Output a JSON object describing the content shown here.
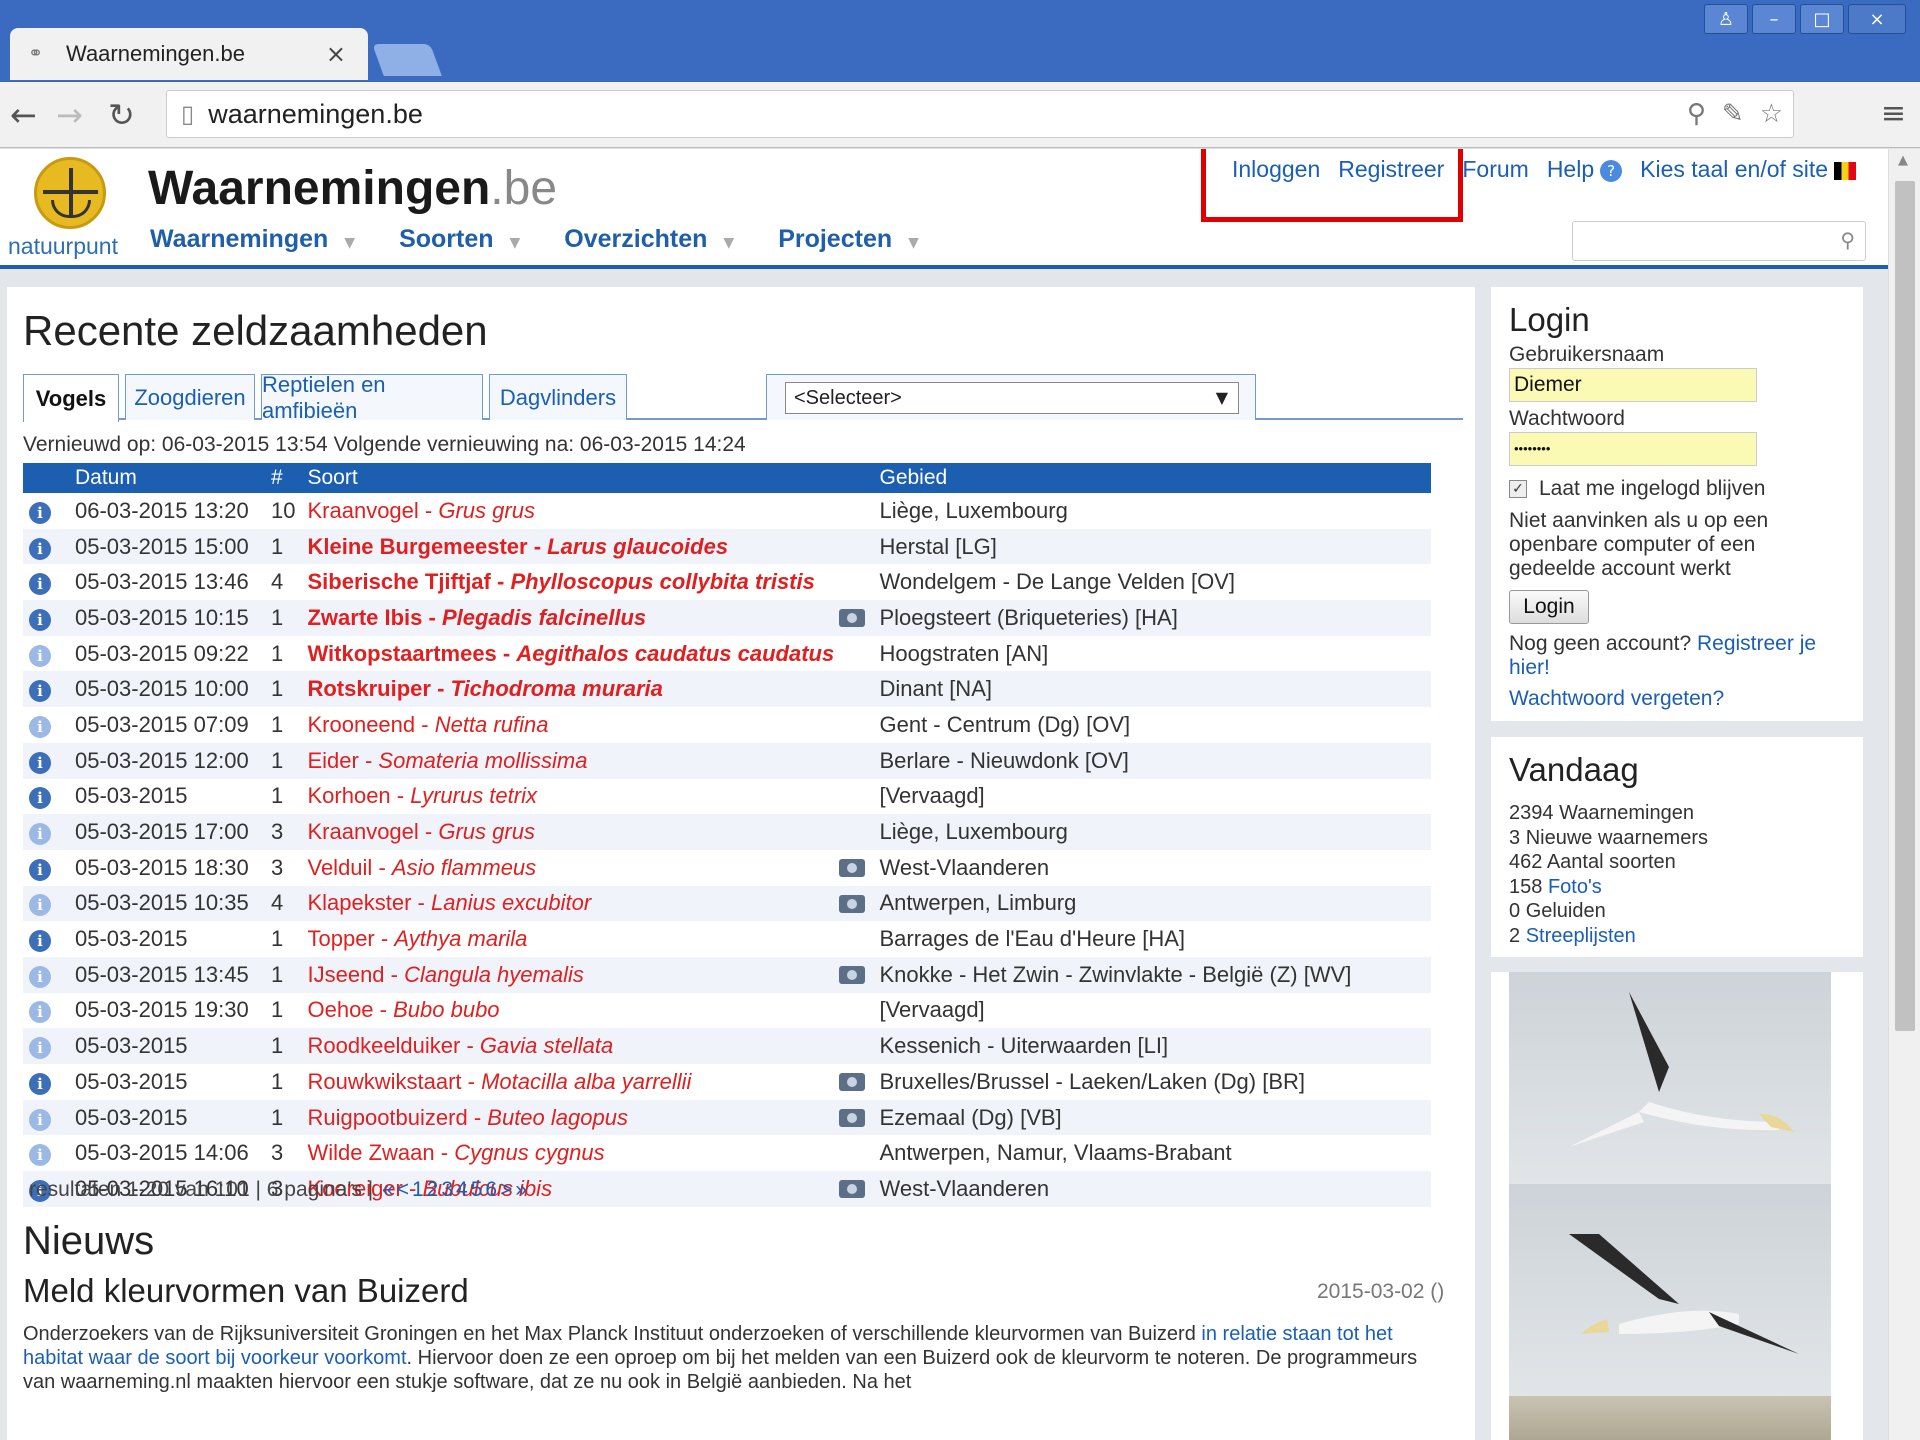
{
  "browser": {
    "tab_title": "Waarnemingen.be",
    "url": "waarnemingen.be"
  },
  "site": {
    "org": "natuurpunt",
    "title_main": "Waarnemingen",
    "title_tld": ".be",
    "nav": [
      "Waarnemingen",
      "Soorten",
      "Overzichten",
      "Projecten"
    ],
    "top_links": {
      "login": "Inloggen",
      "register": "Registreer",
      "forum": "Forum",
      "help": "Help",
      "language": "Kies taal en/of site"
    },
    "accent": "#1c5fb0",
    "highlight_box_color": "#e10000"
  },
  "rare": {
    "title": "Recente zeldzaamheden",
    "tabs": [
      "Vogels",
      "Zoogdieren",
      "Reptielen en amfibieën",
      "Dagvlinders"
    ],
    "select_value": "<Selecteer>",
    "updated": "Vernieuwd op: 06-03-2015 13:54 Volgende vernieuwing na: 06-03-2015 14:24",
    "columns": {
      "datum": "Datum",
      "num": "#",
      "soort": "Soort",
      "gebied": "Gebied"
    },
    "rows": [
      {
        "date": "06-03-2015 13:20",
        "n": "10",
        "name": "Kraanvogel",
        "latin": "Grus grus",
        "area": "Liège, Luxembourg",
        "bold": false,
        "photo": false,
        "light": false
      },
      {
        "date": "05-03-2015 15:00",
        "n": "1",
        "name": "Kleine Burgemeester",
        "latin": "Larus glaucoides",
        "area": "Herstal [LG]",
        "bold": true,
        "photo": false,
        "light": false
      },
      {
        "date": "05-03-2015 13:46",
        "n": "4",
        "name": "Siberische Tjiftjaf",
        "latin": "Phylloscopus collybita tristis",
        "area": "Wondelgem - De Lange Velden [OV]",
        "bold": true,
        "photo": false,
        "light": false
      },
      {
        "date": "05-03-2015 10:15",
        "n": "1",
        "name": "Zwarte Ibis",
        "latin": "Plegadis falcinellus",
        "area": "Ploegsteert (Briqueteries) [HA]",
        "bold": true,
        "photo": true,
        "light": false
      },
      {
        "date": "05-03-2015 09:22",
        "n": "1",
        "name": "Witkopstaartmees",
        "latin": "Aegithalos caudatus caudatus",
        "area": "Hoogstraten [AN]",
        "bold": true,
        "photo": false,
        "light": true
      },
      {
        "date": "05-03-2015 10:00",
        "n": "1",
        "name": "Rotskruiper",
        "latin": "Tichodroma muraria",
        "area": "Dinant [NA]",
        "bold": true,
        "photo": false,
        "light": false
      },
      {
        "date": "05-03-2015 07:09",
        "n": "1",
        "name": "Krooneend",
        "latin": "Netta rufina",
        "area": "Gent - Centrum (Dg) [OV]",
        "bold": false,
        "photo": false,
        "light": true
      },
      {
        "date": "05-03-2015 12:00",
        "n": "1",
        "name": "Eider",
        "latin": "Somateria mollissima",
        "area": "Berlare - Nieuwdonk [OV]",
        "bold": false,
        "photo": false,
        "light": false
      },
      {
        "date": "05-03-2015",
        "n": "1",
        "name": "Korhoen",
        "latin": "Lyrurus tetrix",
        "area": "[Vervaagd]",
        "bold": false,
        "photo": false,
        "light": false
      },
      {
        "date": "05-03-2015 17:00",
        "n": "3",
        "name": "Kraanvogel",
        "latin": "Grus grus",
        "area": "Liège, Luxembourg",
        "bold": false,
        "photo": false,
        "light": true
      },
      {
        "date": "05-03-2015 18:30",
        "n": "3",
        "name": "Velduil",
        "latin": "Asio flammeus",
        "area": "West-Vlaanderen",
        "bold": false,
        "photo": true,
        "light": false
      },
      {
        "date": "05-03-2015 10:35",
        "n": "4",
        "name": "Klapekster",
        "latin": "Lanius excubitor",
        "area": "Antwerpen, Limburg",
        "bold": false,
        "photo": true,
        "light": true
      },
      {
        "date": "05-03-2015",
        "n": "1",
        "name": "Topper",
        "latin": "Aythya marila",
        "area": "Barrages de l'Eau d'Heure [HA]",
        "bold": false,
        "photo": false,
        "light": false
      },
      {
        "date": "05-03-2015 13:45",
        "n": "1",
        "name": "IJseend",
        "latin": "Clangula hyemalis",
        "area": "Knokke - Het Zwin - Zwinvlakte - België (Z) [WV]",
        "bold": false,
        "photo": true,
        "light": true
      },
      {
        "date": "05-03-2015 19:30",
        "n": "1",
        "name": "Oehoe",
        "latin": "Bubo bubo",
        "area": "[Vervaagd]",
        "bold": false,
        "photo": false,
        "light": true
      },
      {
        "date": "05-03-2015",
        "n": "1",
        "name": "Roodkeelduiker",
        "latin": "Gavia stellata",
        "area": "Kessenich - Uiterwaarden [LI]",
        "bold": false,
        "photo": false,
        "light": true
      },
      {
        "date": "05-03-2015",
        "n": "1",
        "name": "Rouwkwikstaart",
        "latin": "Motacilla alba yarrellii",
        "area": "Bruxelles/Brussel - Laeken/Laken (Dg) [BR]",
        "bold": false,
        "photo": true,
        "light": false
      },
      {
        "date": "05-03-2015",
        "n": "1",
        "name": "Ruigpootbuizerd",
        "latin": "Buteo lagopus",
        "area": "Ezemaal (Dg) [VB]",
        "bold": false,
        "photo": true,
        "light": true
      },
      {
        "date": "05-03-2015 14:06",
        "n": "3",
        "name": "Wilde Zwaan",
        "latin": "Cygnus cygnus",
        "area": "Antwerpen, Namur, Vlaams-Brabant",
        "bold": false,
        "photo": false,
        "light": true
      },
      {
        "date": "05-03-2015 16:10",
        "n": "3",
        "name": "Koereiger",
        "latin": "Bubulcus ibis",
        "area": "West-Vlaanderen",
        "bold": false,
        "photo": true,
        "light": false
      }
    ],
    "pager_text": "resultaten 1-20 van 101 | 6 pagina's |",
    "pager_links": [
      "«",
      "<",
      "1",
      "2",
      "3",
      "4",
      "5",
      "6",
      ">",
      "»"
    ]
  },
  "news": {
    "title": "Nieuws",
    "item_title": "Meld kleurvormen van Buizerd",
    "item_date": "2015-03-02 ()",
    "body_1": "Onderzoekers van de Rijksuniversiteit Groningen en het Max Planck Instituut onderzoeken of verschillende kleurvormen van Buizerd",
    "body_link": "in relatie staan tot het habitat waar de soort bij voorkeur voorkomt",
    "body_2": ". Hiervoor doen ze een oproep om bij het melden van een Buizerd ook de kleurvorm te noteren. De programmeurs van waarneming.nl maakten hiervoor een stukje software, dat ze nu ook in België aanbieden. Na het"
  },
  "login": {
    "title": "Login",
    "user_label": "Gebruikersnaam",
    "user_value": "Diemer",
    "pass_label": "Wachtwoord",
    "pass_value": "••••••••",
    "remember": "Laat me ingelogd blijven",
    "hint": "Niet aanvinken als u op een openbare computer of een gedeelde account werkt",
    "button": "Login",
    "no_account": "Nog geen account?",
    "register_link": "Registreer je hier!",
    "forgot": "Wachtwoord vergeten?"
  },
  "today": {
    "title": "Vandaag",
    "stats": [
      {
        "num": "2394",
        "label": "Waarnemingen",
        "link": false
      },
      {
        "num": "3",
        "label": "Nieuwe waarnemers",
        "link": false
      },
      {
        "num": "462",
        "label": "Aantal soorten",
        "link": false
      },
      {
        "num": "158",
        "label": "Foto's",
        "link": true
      },
      {
        "num": "0",
        "label": "Geluiden",
        "link": false
      },
      {
        "num": "2",
        "label": "Streeplijsten",
        "link": true
      }
    ]
  },
  "icons": {
    "info": "i",
    "camera": "camera-icon"
  }
}
